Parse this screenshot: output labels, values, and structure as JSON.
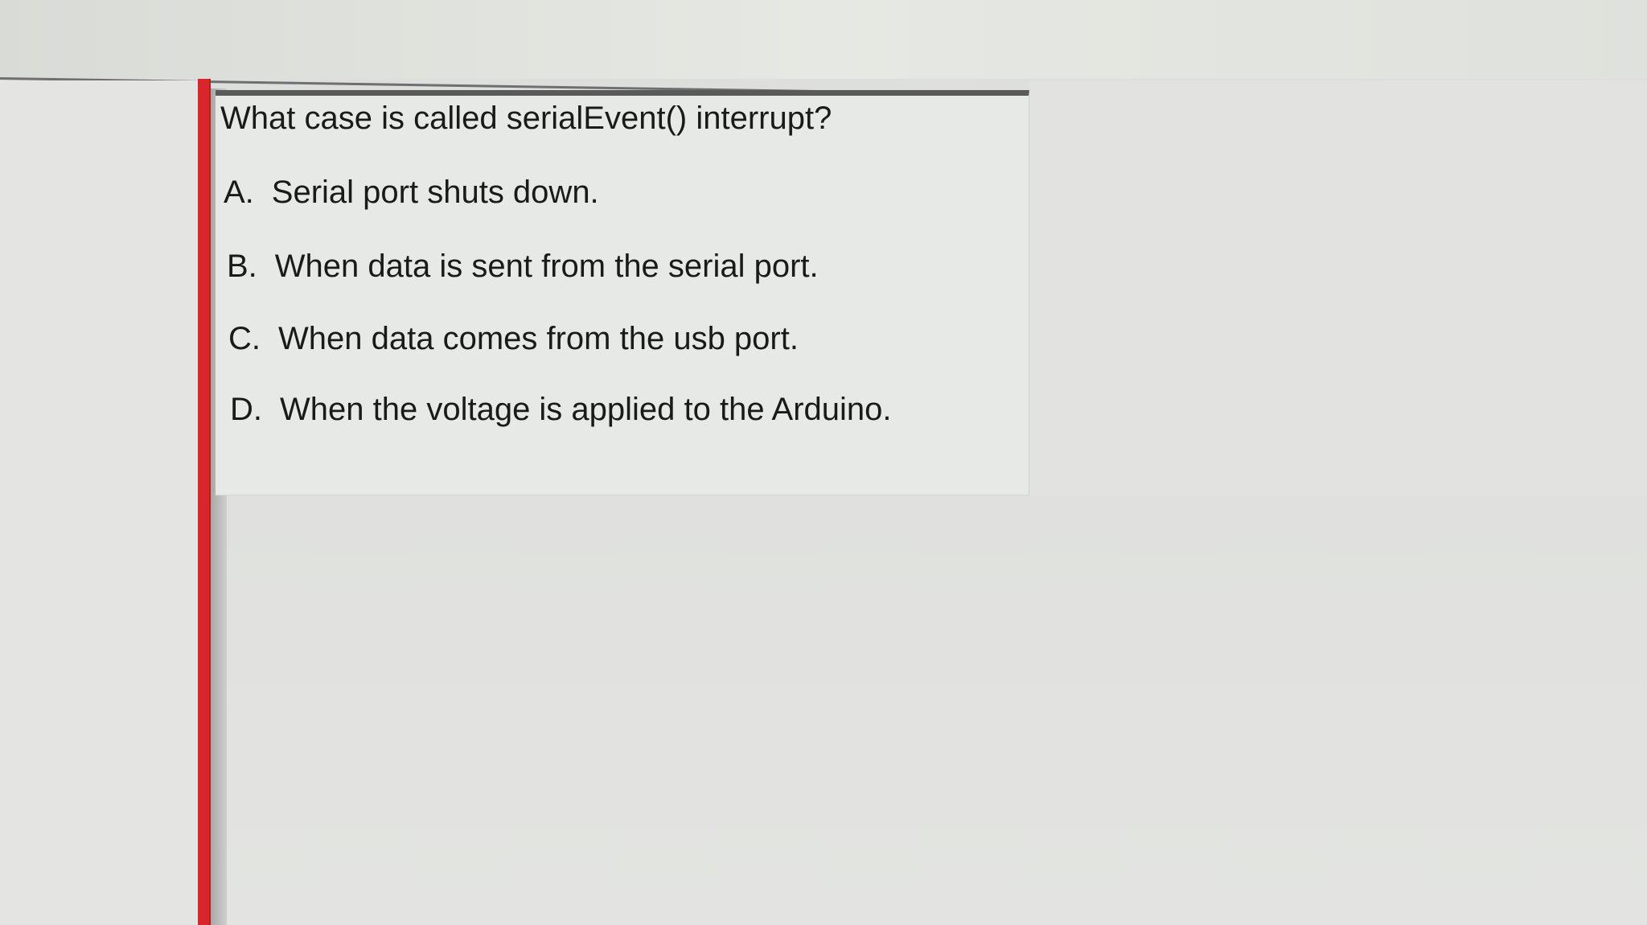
{
  "question": {
    "text": "What case is called serialEvent() interrupt?"
  },
  "options": [
    {
      "letter": "A.",
      "text": "Serial port shuts down."
    },
    {
      "letter": "B.",
      "text": "When data is sent from the serial port."
    },
    {
      "letter": "C.",
      "text": "When data comes from the usb port."
    },
    {
      "letter": "D.",
      "text": "When the voltage is applied to the Arduino."
    }
  ],
  "colors": {
    "accent": "#d9262a",
    "panel_border": "#5a5a5a",
    "text": "#1a1a1a"
  }
}
